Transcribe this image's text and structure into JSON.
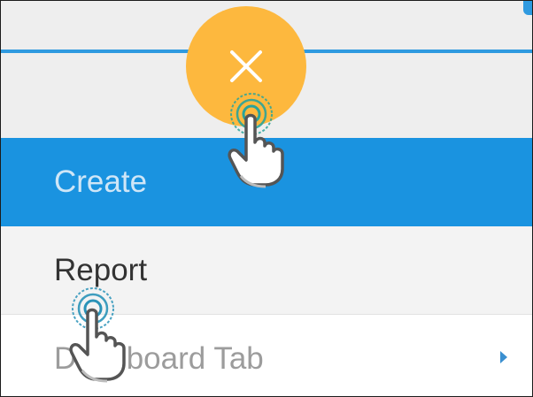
{
  "menu": {
    "items": [
      {
        "label": "Create",
        "state": "selected"
      },
      {
        "label": "Report",
        "state": "hover"
      },
      {
        "label": "Dashboard Tab",
        "state": "normal",
        "has_submenu": true
      }
    ]
  },
  "fab": {
    "icon": "close-icon",
    "color": "#fdb83e"
  },
  "accent_colors": {
    "primary_blue": "#1a93e0",
    "line_blue": "#2f9ae0",
    "fab_orange": "#fdb83e"
  },
  "annotations": [
    {
      "icon": "tap-hand-icon",
      "target": "fab-close-button"
    },
    {
      "icon": "tap-hand-icon",
      "target": "menu-item-report"
    }
  ]
}
